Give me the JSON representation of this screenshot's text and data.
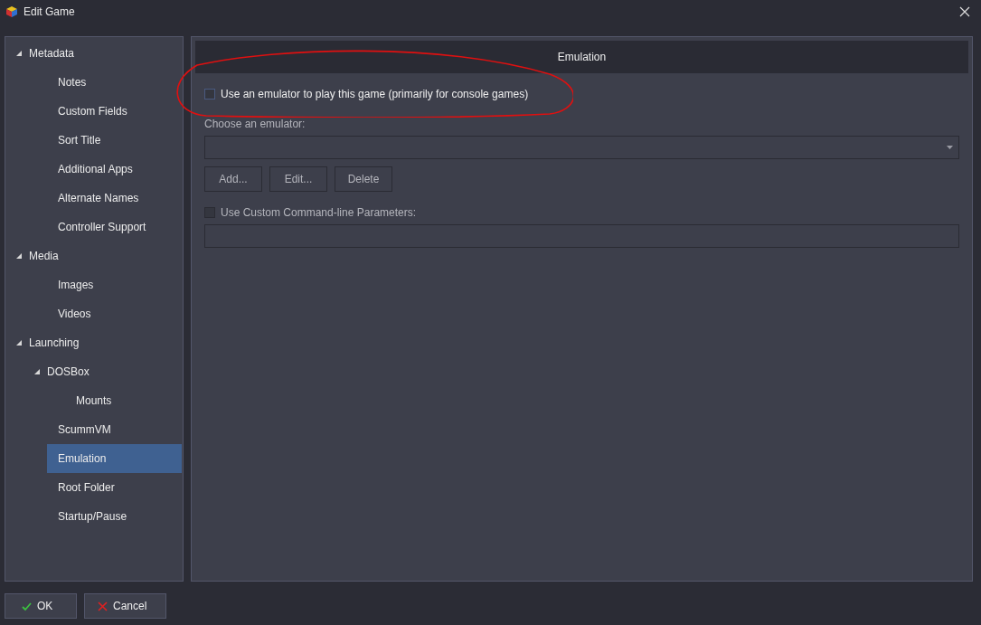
{
  "window": {
    "title": "Edit Game"
  },
  "sidebar": {
    "items": [
      {
        "label": "Metadata",
        "expanded": true,
        "selected": false,
        "children": [
          {
            "label": "Notes",
            "selected": false
          },
          {
            "label": "Custom Fields",
            "selected": false
          },
          {
            "label": "Sort Title",
            "selected": false
          },
          {
            "label": "Additional Apps",
            "selected": false
          },
          {
            "label": "Alternate Names",
            "selected": false
          },
          {
            "label": "Controller Support",
            "selected": false
          }
        ]
      },
      {
        "label": "Media",
        "expanded": true,
        "selected": false,
        "children": [
          {
            "label": "Images",
            "selected": false
          },
          {
            "label": "Videos",
            "selected": false
          }
        ]
      },
      {
        "label": "Launching",
        "expanded": true,
        "selected": false,
        "children": [
          {
            "label": "DOSBox",
            "expanded": true,
            "selected": false,
            "children": [
              {
                "label": "Mounts",
                "selected": false
              }
            ]
          },
          {
            "label": "ScummVM",
            "selected": false
          },
          {
            "label": "Emulation",
            "selected": true
          },
          {
            "label": "Root Folder",
            "selected": false
          },
          {
            "label": "Startup/Pause",
            "selected": false
          }
        ]
      }
    ]
  },
  "panel": {
    "header": "Emulation",
    "use_emulator": {
      "label": "Use an emulator to play this game (primarily for console games)",
      "checked": false,
      "disabled": false
    },
    "emulator_label": "Choose an emulator:",
    "emulator_dropdown": {
      "disabled": true
    },
    "buttons": [
      {
        "label": "Add...",
        "disabled": true
      },
      {
        "label": "Edit...",
        "disabled": true
      },
      {
        "label": "Delete",
        "disabled": true
      }
    ],
    "custom_params": {
      "label": "Use Custom Command-line Parameters:",
      "checked": false,
      "disabled": true
    },
    "params_field": {
      "disabled": true
    }
  },
  "footer": {
    "buttons": [
      {
        "label": "OK",
        "kind": "ok"
      },
      {
        "label": "Cancel",
        "kind": "cancel"
      }
    ]
  }
}
